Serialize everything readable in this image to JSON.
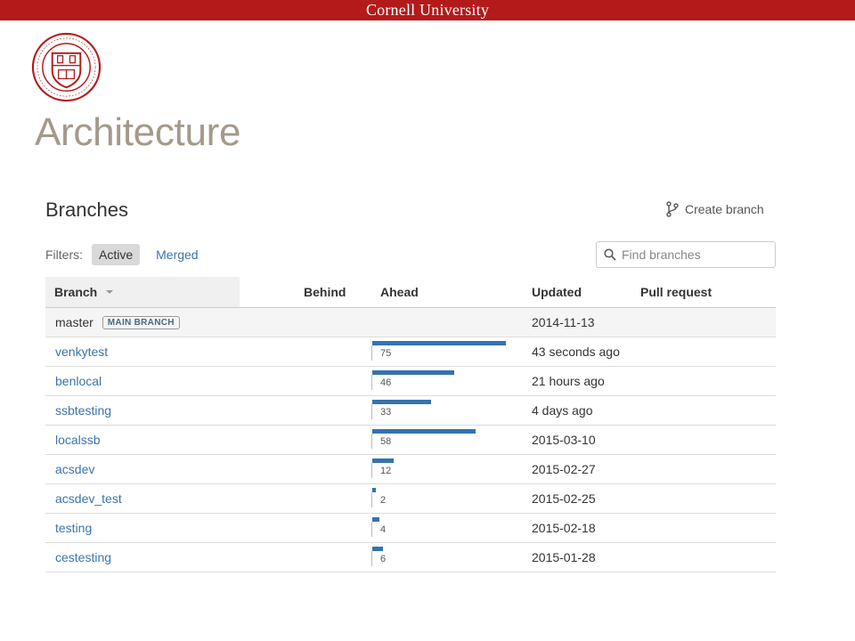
{
  "header": {
    "university": "Cornell University",
    "site_title": "Architecture",
    "brand_color": "#b31b1b"
  },
  "branches": {
    "title": "Branches",
    "create_label": "Create branch",
    "filters_label": "Filters:",
    "filter_active": "Active",
    "filter_merged": "Merged",
    "search_placeholder": "Find branches",
    "columns": {
      "branch": "Branch",
      "behind": "Behind",
      "ahead": "Ahead",
      "updated": "Updated",
      "pull_request": "Pull request"
    },
    "main_badge": "MAIN BRANCH",
    "ahead_max": 75,
    "rows": [
      {
        "name": "master",
        "is_main": true,
        "ahead": null,
        "updated": "2014-11-13"
      },
      {
        "name": "venkytest",
        "is_main": false,
        "ahead": 75,
        "updated": "43 seconds ago"
      },
      {
        "name": "benlocal",
        "is_main": false,
        "ahead": 46,
        "updated": "21 hours ago"
      },
      {
        "name": "ssbtesting",
        "is_main": false,
        "ahead": 33,
        "updated": "4 days ago"
      },
      {
        "name": "localssb",
        "is_main": false,
        "ahead": 58,
        "updated": "2015-03-10"
      },
      {
        "name": "acsdev",
        "is_main": false,
        "ahead": 12,
        "updated": "2015-02-27"
      },
      {
        "name": "acsdev_test",
        "is_main": false,
        "ahead": 2,
        "updated": "2015-02-25"
      },
      {
        "name": "testing",
        "is_main": false,
        "ahead": 4,
        "updated": "2015-02-18"
      },
      {
        "name": "cestesting",
        "is_main": false,
        "ahead": 6,
        "updated": "2015-01-28"
      }
    ]
  },
  "icons": {
    "seal": "cornell-seal-icon",
    "create": "branch-icon",
    "search": "search-icon",
    "sort": "sort-caret-icon"
  },
  "colors": {
    "title": "#a39a8a",
    "link": "#3b73af",
    "bar": "#3572b0"
  }
}
